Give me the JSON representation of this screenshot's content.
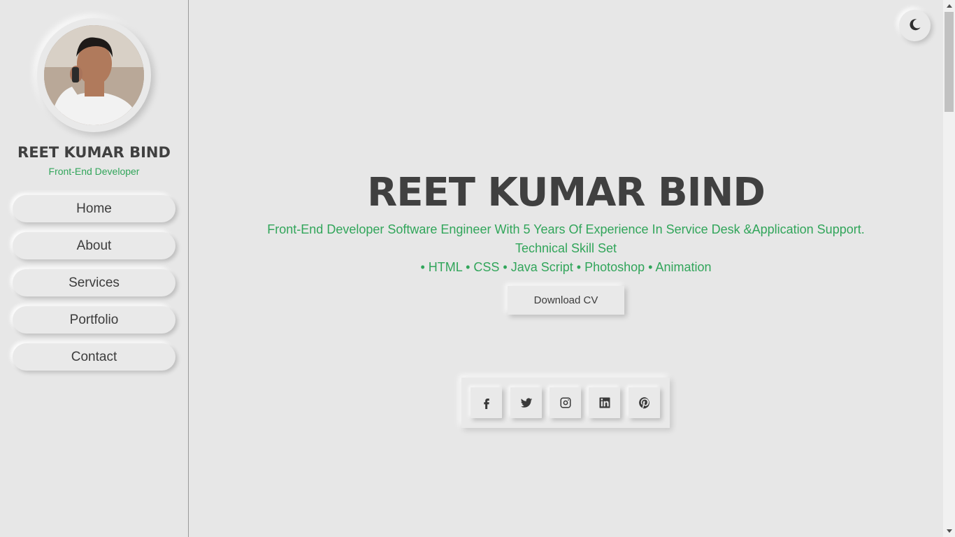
{
  "sidebar": {
    "name": "REET KUMAR BIND",
    "role": "Front-End Developer",
    "nav": [
      {
        "label": "Home"
      },
      {
        "label": "About"
      },
      {
        "label": "Services"
      },
      {
        "label": "Portfolio"
      },
      {
        "label": "Contact"
      }
    ]
  },
  "hero": {
    "title": "REET KUMAR BIND",
    "line1": "Front-End Developer Software Engineer With 5 Years Of Experience In Service Desk &Application Support.",
    "line2": "Technical Skill Set",
    "line3": "• HTML • CSS • Java Script • Photoshop • Animation",
    "cv_button": "Download CV"
  },
  "social": [
    {
      "icon": "facebook-icon"
    },
    {
      "icon": "twitter-icon"
    },
    {
      "icon": "instagram-icon"
    },
    {
      "icon": "linkedin-icon"
    },
    {
      "icon": "pinterest-icon"
    }
  ],
  "theme_toggle": {
    "icon": "moon-icon"
  },
  "colors": {
    "background": "#e7e7e7",
    "accent": "#31a55a",
    "text": "#404040"
  }
}
